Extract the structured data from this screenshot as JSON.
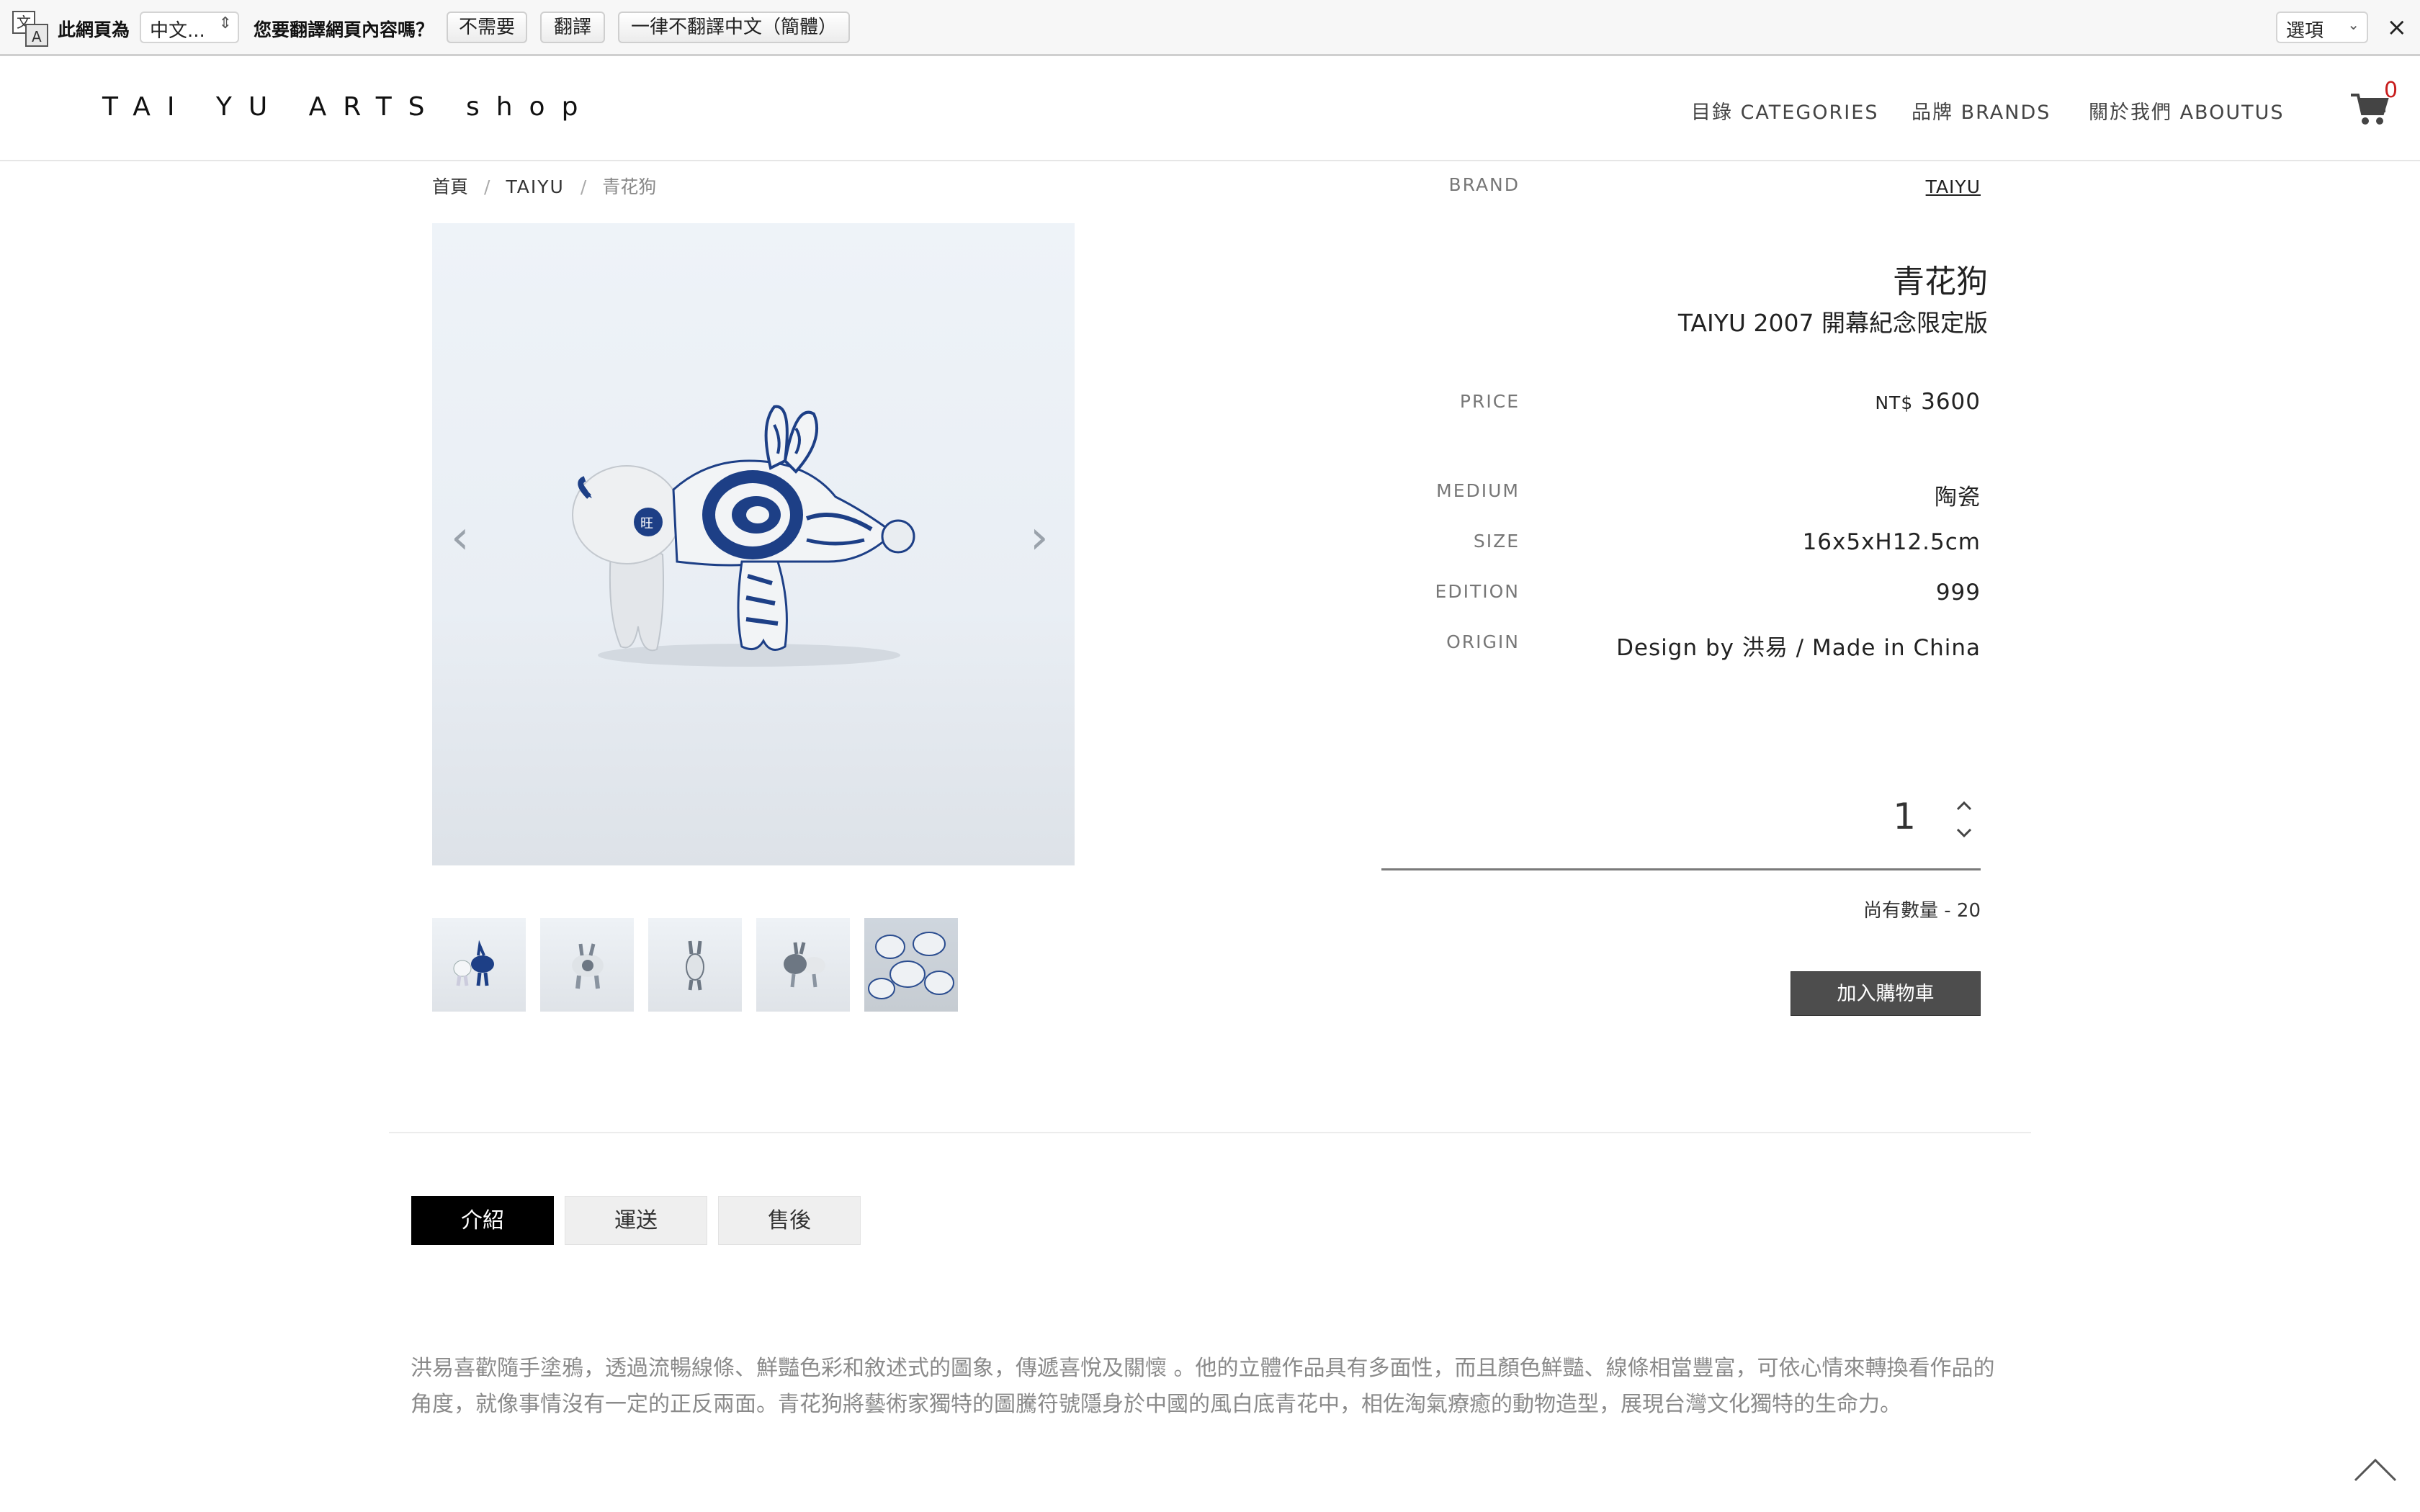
{
  "translate_bar": {
    "icon": "translate-icon",
    "prefix": "此網頁為",
    "language": "中文...",
    "question": "您要翻譯網頁內容嗎？",
    "no_button": "不需要",
    "translate_button": "翻譯",
    "never_button": "一律不翻譯中文（簡體）",
    "options": "選項",
    "close": "×"
  },
  "header": {
    "logo": "TAI YU ARTS shop",
    "nav": [
      "目錄 CATEGORIES",
      "品牌 BRANDS",
      "關於我們 ABOUTUS"
    ],
    "cart_count": "0"
  },
  "breadcrumb": {
    "home": "首頁",
    "brand": "TAIYU",
    "current": "青花狗",
    "separator": "/"
  },
  "gallery": {
    "prev": "‹",
    "next": "›",
    "thumbnail_count": 5
  },
  "product": {
    "brand_label": "BRAND",
    "brand_value": "TAIYU",
    "title": "青花狗",
    "subtitle": "TAIYU 2007 開幕紀念限定版",
    "price_label": "PRICE",
    "price_currency": "NT$",
    "price_value": "3600",
    "specs": [
      {
        "label": "MEDIUM",
        "value": "陶瓷"
      },
      {
        "label": "SIZE",
        "value": "16x5xH12.5cm"
      },
      {
        "label": "EDITION",
        "value": "999"
      },
      {
        "label": "ORIGIN",
        "value": "Design by 洪易 / Made in China"
      }
    ],
    "quantity": "1",
    "stock": "尚有數量 - 20",
    "add_to_cart": "加入購物車"
  },
  "tabs": [
    {
      "label": "介紹",
      "active": true
    },
    {
      "label": "運送",
      "active": false
    },
    {
      "label": "售後",
      "active": false
    }
  ],
  "description": "洪易喜歡隨手塗鴉，透過流暢線條、鮮豔色彩和敘述式的圖象，傳遞喜悅及關懷 。他的立體作品具有多面性，而且顏色鮮豔、線條相當豐富，可依心情來轉換看作品的角度，就像事情沒有一定的正反兩面。青花狗將藝術家獨特的圖騰符號隱身於中國的風白底青花中，相佐淘氣療癒的動物造型，展現台灣文化獨特的生命力。",
  "colors": {
    "accent_cart": "#c81e1e",
    "button_dark": "#4d4d4d",
    "tab_active": "#000000",
    "porcelain_blue": "#1d3f86"
  }
}
